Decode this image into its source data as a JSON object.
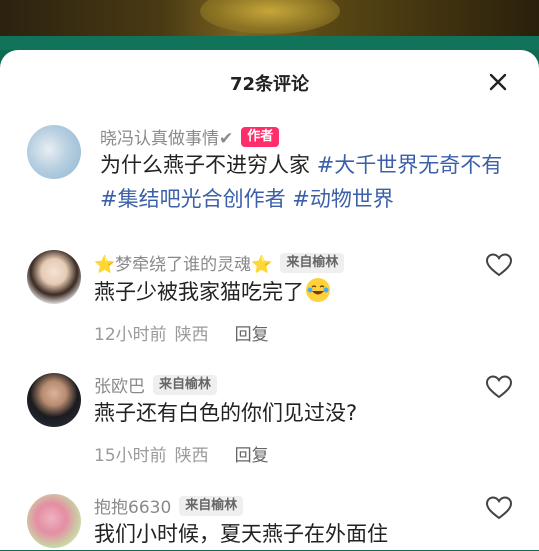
{
  "header": {
    "title": "72条评论",
    "close_icon": "close-icon"
  },
  "post": {
    "author": "晓冯认真做事情✔",
    "author_badge": "作者",
    "text": "为什么燕子不进穷人家 ",
    "hashtags": [
      "#大千世界无奇不有",
      "#集结吧光合创作者",
      "#动物世界"
    ]
  },
  "comments": [
    {
      "name": "⭐梦牵绕了谁的灵魂⭐",
      "location_badge": "来自榆林",
      "text": "燕子少被我家猫吃完了",
      "emoji": "crying-laughing-emoji",
      "time": "12小时前",
      "region": "陕西",
      "reply": "回复"
    },
    {
      "name": "张欧巴",
      "location_badge": "来自榆林",
      "text": "燕子还有白色的你们见过没?",
      "time": "15小时前",
      "region": "陕西",
      "reply": "回复"
    },
    {
      "name": "抱抱6630",
      "location_badge": "来自榆林",
      "text": "我们小时候，夏天燕子在外面住"
    }
  ],
  "icons": {
    "heart": "heart-outline-icon",
    "close": "close-icon"
  },
  "colors": {
    "teal": "#10735a",
    "author_badge": "#ff2e6a",
    "hashtag": "#3b5fa8"
  }
}
